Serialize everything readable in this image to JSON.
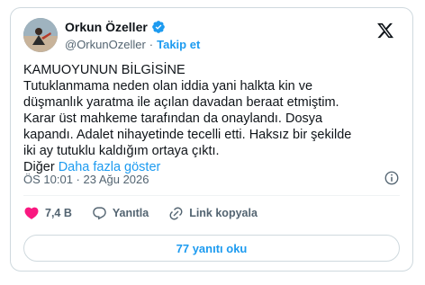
{
  "author": {
    "display_name": "Orkun Özeller",
    "handle": "@OrkunOzeller",
    "separator": "·",
    "follow_label": "Takip et",
    "verified": true
  },
  "tweet": {
    "heading": "KAMUOYUNUN BİLGİSİNE",
    "body": "Tutuklanmama neden olan iddia yani halkta kin ve\ndüşmanlık yaratma ile açılan davadan beraat etmiştim.\nKarar üst mahkeme tarafından da onaylandı. Dosya\nkapandı. Adalet nihayetinde tecelli etti. Haksız bir şekilde\niki ay tutuklu kaldığım ortaya çıktı.\nDiğer ",
    "show_more_label": "Daha fazla göster",
    "timestamp": "ÖS 10:01 · 23 Ağu 2026"
  },
  "actions": {
    "like_count": "7,4 B",
    "reply_label": "Yanıtla",
    "copy_link_label": "Link kopyala"
  },
  "footer": {
    "read_replies_label": "77 yanıtı oku"
  },
  "colors": {
    "accent": "#1d9bf0",
    "like": "#f91880",
    "muted": "#536471",
    "text": "#0f1419",
    "border": "#cfd9de"
  },
  "icons": {
    "brand": "x-logo-icon",
    "verified": "verified-badge-icon",
    "info": "info-icon",
    "like": "heart-icon",
    "reply": "speech-bubble-icon",
    "link": "link-icon"
  }
}
